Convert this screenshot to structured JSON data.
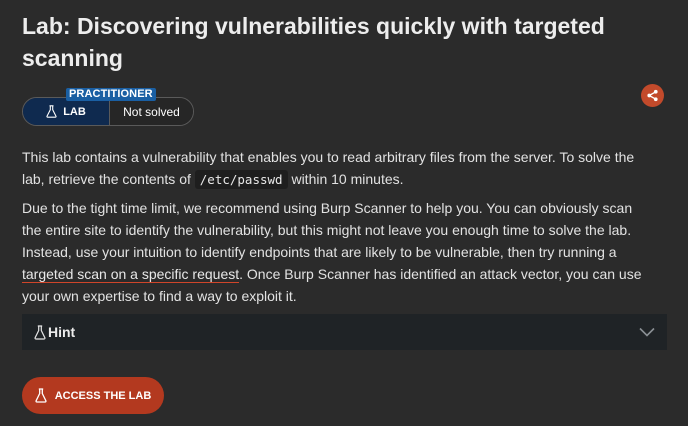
{
  "page": {
    "title": "Lab: Discovering vulnerabilities quickly with targeted scanning"
  },
  "badges": {
    "level": "PRACTITIONER",
    "type": "LAB",
    "status": "Not solved"
  },
  "description": {
    "p1_before": "This lab contains a vulnerability that enables you to read arbitrary files from the server. To solve the lab, retrieve the contents of ",
    "p1_code": "/etc/passwd",
    "p1_after": " within 10 minutes.",
    "p2_before": "Due to the tight time limit, we recommend using Burp Scanner to help you. You can obviously scan the entire site to identify the vulnerability, but this might not leave you enough time to solve the lab. Instead, use your intuition to identify endpoints that are likely to be vulnerable, then try running a ",
    "p2_link": "targeted scan on a specific request",
    "p2_after": ". Once Burp Scanner has identified an attack vector, you can use your own expertise to find a way to exploit it."
  },
  "hint": {
    "label": "Hint"
  },
  "actions": {
    "access_label": "ACCESS THE LAB"
  },
  "icons": {
    "share": "share-icon",
    "flask": "flask-icon",
    "chevron": "chevron-down-icon"
  },
  "colors": {
    "background": "#2b2b2b",
    "accent": "#c24a2b",
    "level_badge": "#1a5fa3",
    "lab_badge": "#0f2a4f",
    "hint_bar": "#1f2326"
  }
}
